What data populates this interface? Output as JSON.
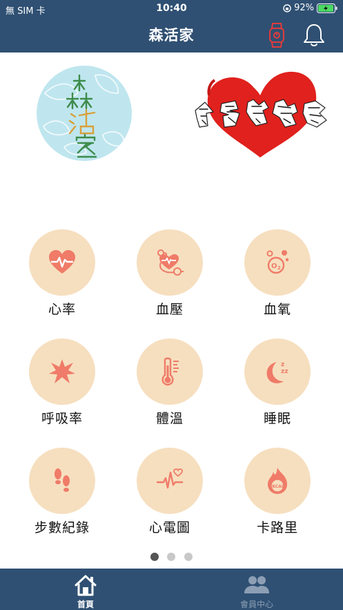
{
  "status": {
    "carrier": "無 SIM 卡",
    "time": "10:40",
    "battery": "92%"
  },
  "header": {
    "title": "森活家"
  },
  "logos": {
    "left_text": "森活家",
    "right_text": "食氧律動愛"
  },
  "tiles": [
    {
      "label": "心率",
      "icon": "heart-pulse-icon"
    },
    {
      "label": "血壓",
      "icon": "blood-pressure-icon"
    },
    {
      "label": "血氧",
      "icon": "oxygen-icon"
    },
    {
      "label": "呼吸率",
      "icon": "respiration-icon"
    },
    {
      "label": "體溫",
      "icon": "thermometer-icon"
    },
    {
      "label": "睡眠",
      "icon": "sleep-moon-icon"
    },
    {
      "label": "步數紀錄",
      "icon": "footsteps-icon"
    },
    {
      "label": "心電圖",
      "icon": "ecg-icon"
    },
    {
      "label": "卡路里",
      "icon": "calorie-flame-icon"
    }
  ],
  "pager": {
    "pages": 3,
    "current": 1
  },
  "tabbar": {
    "items": [
      {
        "label": "首頁",
        "icon": "home-icon",
        "active": true
      },
      {
        "label": "會員中心",
        "icon": "members-icon",
        "active": false
      }
    ]
  },
  "colors": {
    "bar": "#2f5073",
    "tile_bg": "#f6dfbf",
    "icon_accent": "#ef7b68",
    "watch": "#e23b3b",
    "tab_active": "#ffffff",
    "tab_inactive": "#8d9fb4"
  }
}
